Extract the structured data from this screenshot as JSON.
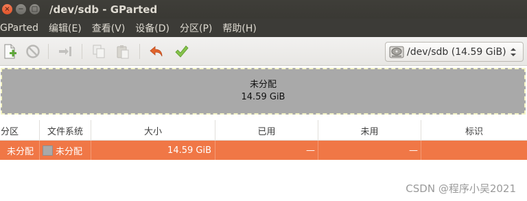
{
  "window": {
    "title": "/dev/sdb - GParted",
    "close_glyph": "×",
    "minimize_glyph": "−",
    "maximize_glyph": "□"
  },
  "menu": [
    {
      "label": "GParted"
    },
    {
      "label": "编辑(E)"
    },
    {
      "label": "查看(V)"
    },
    {
      "label": "设备(D)"
    },
    {
      "label": "分区(P)"
    },
    {
      "label": "帮助(H)"
    }
  ],
  "toolbar": {
    "icons": [
      "new-partition-icon",
      "delete-icon",
      "resize-move-icon",
      "copy-icon",
      "paste-icon",
      "undo-icon",
      "apply-icon"
    ],
    "device_label": "/dev/sdb  (14.59 GiB)"
  },
  "graphic": {
    "label": "未分配",
    "size": "14.59 GiB"
  },
  "table": {
    "columns": [
      "分区",
      "文件系统",
      "大小",
      "已用",
      "未用",
      "标识"
    ],
    "rows": [
      {
        "partition": "未分配",
        "filesystem": "未分配",
        "size": "14.59 GiB",
        "used": "—",
        "unused": "—",
        "flags": ""
      }
    ]
  },
  "colors": {
    "selection": "#f07746",
    "unallocated": "#a9a9a9",
    "titlebar": "#3c3b37"
  },
  "watermark": "CSDN @程序小吴2021"
}
